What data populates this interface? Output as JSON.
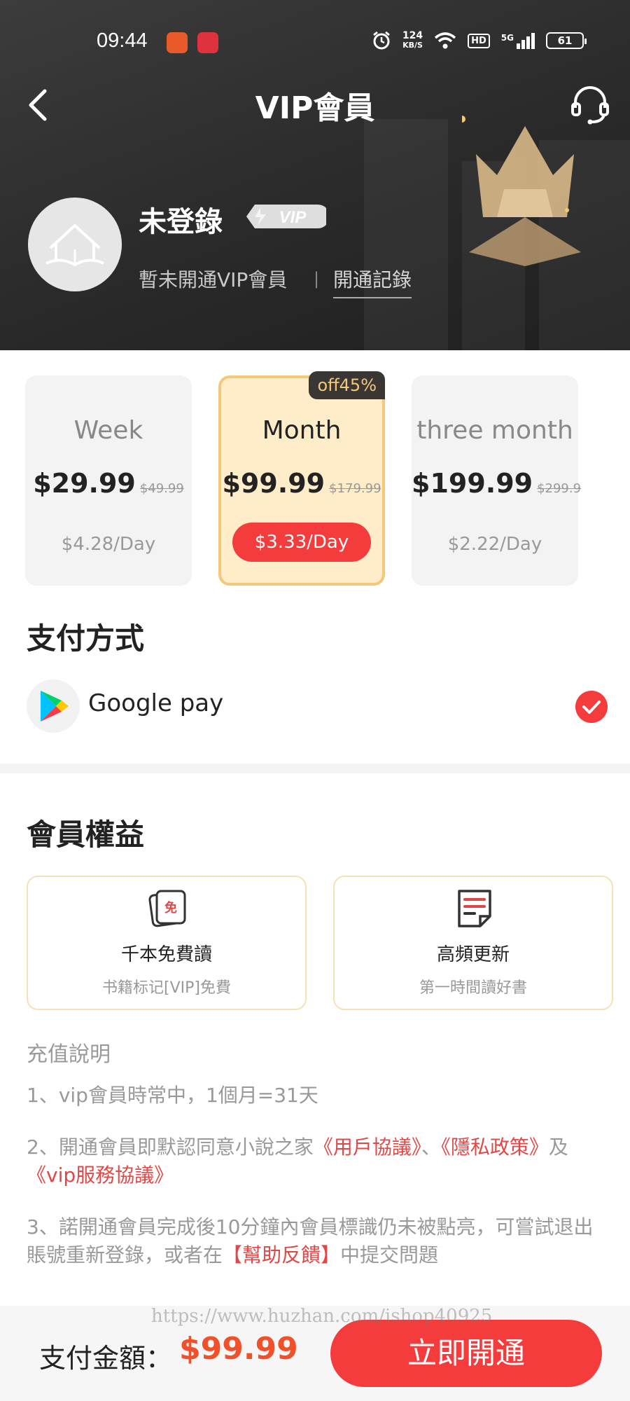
{
  "status_bar": {
    "time": "09:44",
    "net_speed_value": "124",
    "net_speed_unit": "KB/S",
    "hd": "HD",
    "signal": "5G",
    "battery": "61"
  },
  "header": {
    "title": "VIP會員",
    "user_name": "未登錄",
    "vip_badge": "VIP",
    "vip_status": "暫未開通VIP會員",
    "divider": "|",
    "record_link": "開通記錄"
  },
  "plans": [
    {
      "name": "Week",
      "price": "$29.99",
      "original": "$49.99",
      "per_day": "$4.28/Day",
      "selected": false
    },
    {
      "name": "Month",
      "price": "$99.99",
      "original": "$179.99",
      "per_day": "$3.33/Day",
      "selected": true,
      "discount": "off45%"
    },
    {
      "name": "three month",
      "price": "$199.99",
      "original": "$299.9",
      "per_day": "$2.22/Day",
      "selected": false
    }
  ],
  "payment": {
    "section_title": "支付方式",
    "method": "Google pay"
  },
  "benefits": {
    "section_title": "會員權益",
    "items": [
      {
        "icon": "free-read-icon",
        "icon_text": "免",
        "title": "千本免費讀",
        "sub": "书籍标记[VIP]免費"
      },
      {
        "icon": "update-icon",
        "title": "高頻更新",
        "sub": "第一時間讀好書"
      }
    ]
  },
  "notes": {
    "title": "充值說明",
    "n1": "1、vip會員時常中，1個月=31天",
    "n2_a": "2、開通會員即默認同意小說之家",
    "n2_link1": "《用戶協議》",
    "n2_sep": "、",
    "n2_link2": "《隱私政策》",
    "n2_and": "及",
    "n2_link3": "《vip服務協議》",
    "n3_a": "3、諾開通會員完成後10分鐘內會員標識仍未被點亮，可嘗試退出賬號重新登錄，或者在",
    "n3_link": "【幫助反饋】",
    "n3_b": "中提交問題"
  },
  "footer": {
    "pay_label": "支付金額：",
    "pay_amount": "$99.99",
    "open_button": "立即開通",
    "watermark": "https://www.huzhan.com/ishop40925"
  },
  "colors": {
    "accent_red": "#f43c3c",
    "price_orange": "#f0502a",
    "gold": "#f4c87a"
  }
}
